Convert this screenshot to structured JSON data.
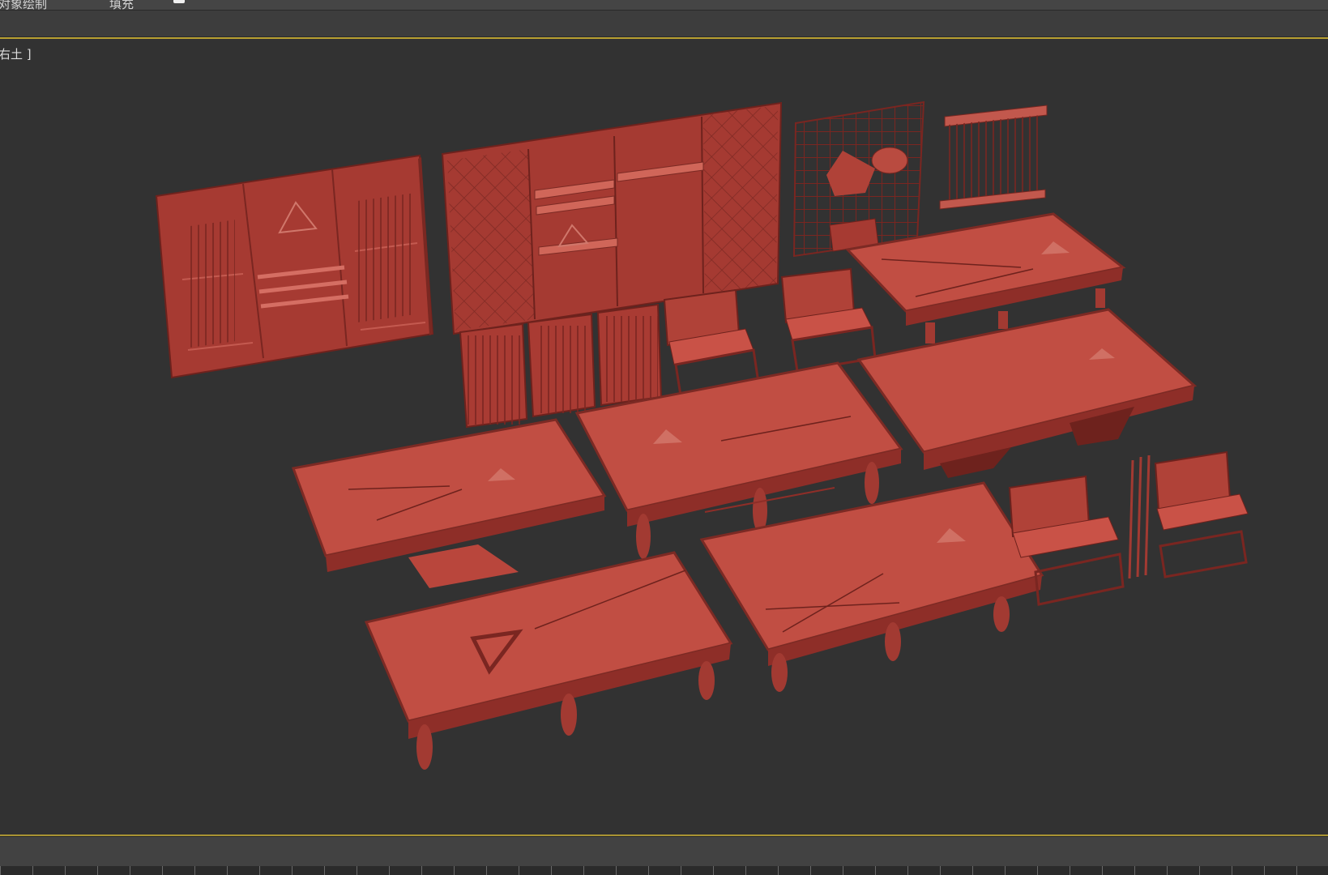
{
  "toolbar": {
    "label_left": "对象绘制",
    "label_mid": "填充"
  },
  "viewport": {
    "label": "右土 ]"
  },
  "scene": {
    "model_color": "#b8473d",
    "objects": [
      "wall-panel-left",
      "cue-cabinet-wall",
      "lattice-rack",
      "cue-wall-rack",
      "pool-table",
      "sofa",
      "pool-table-pedestal",
      "cue-stand"
    ]
  }
}
